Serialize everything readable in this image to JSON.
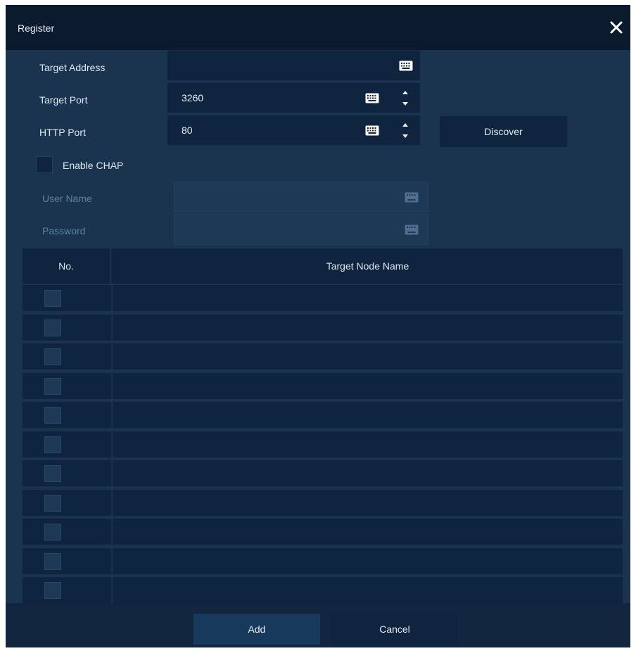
{
  "dialog": {
    "title": "Register"
  },
  "form": {
    "target_address": {
      "label": "Target Address",
      "value": ""
    },
    "target_port": {
      "label": "Target Port",
      "value": "3260"
    },
    "http_port": {
      "label": "HTTP Port",
      "value": "80"
    },
    "discover_label": "Discover",
    "enable_chap": {
      "label": "Enable CHAP",
      "checked": false
    },
    "user_name": {
      "label": "User Name",
      "value": "",
      "disabled": true
    },
    "password": {
      "label": "Password",
      "value": "",
      "disabled": true
    }
  },
  "table": {
    "columns": [
      "No.",
      "Target Node Name"
    ],
    "rows": [
      {
        "no": "",
        "name": ""
      },
      {
        "no": "",
        "name": ""
      },
      {
        "no": "",
        "name": ""
      },
      {
        "no": "",
        "name": ""
      },
      {
        "no": "",
        "name": ""
      },
      {
        "no": "",
        "name": ""
      },
      {
        "no": "",
        "name": ""
      },
      {
        "no": "",
        "name": ""
      },
      {
        "no": "",
        "name": ""
      },
      {
        "no": "",
        "name": ""
      },
      {
        "no": "",
        "name": ""
      }
    ]
  },
  "footer": {
    "add_label": "Add",
    "cancel_label": "Cancel"
  },
  "icons": {
    "close": "close-icon",
    "keyboard": "keyboard-icon",
    "spinner": "spinner-arrows-icon"
  },
  "colors": {
    "title_bar": "#0c1a2e",
    "body": "#1a3450",
    "field": "#0f243e",
    "add_button": "#173a5c",
    "disabled_text": "#5f7f9e"
  }
}
